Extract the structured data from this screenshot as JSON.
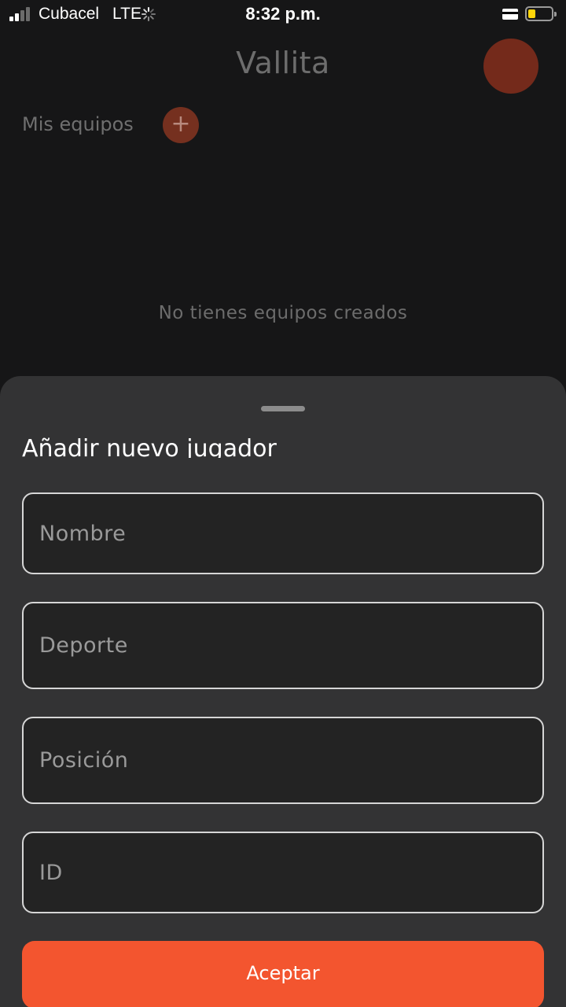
{
  "status_bar": {
    "carrier": "Cubacel",
    "network": "LTE",
    "time": "8:32 p.m.",
    "battery_level": 0.3,
    "battery_color": "#ffd60a"
  },
  "header": {
    "title": "Vallita",
    "avatar_color": "#742a1b"
  },
  "teams": {
    "section_label": "Mis equipos",
    "add_symbol": "+",
    "empty_message": "No tienes equipos creados"
  },
  "sheet": {
    "title": "Añadir nuevo jugador",
    "fields": {
      "name_placeholder": "Nombre",
      "sport_placeholder": "Deporte",
      "position_placeholder": "Posición",
      "id_placeholder": "ID"
    },
    "accept_label": "Aceptar",
    "accent_color": "#f3552f"
  }
}
